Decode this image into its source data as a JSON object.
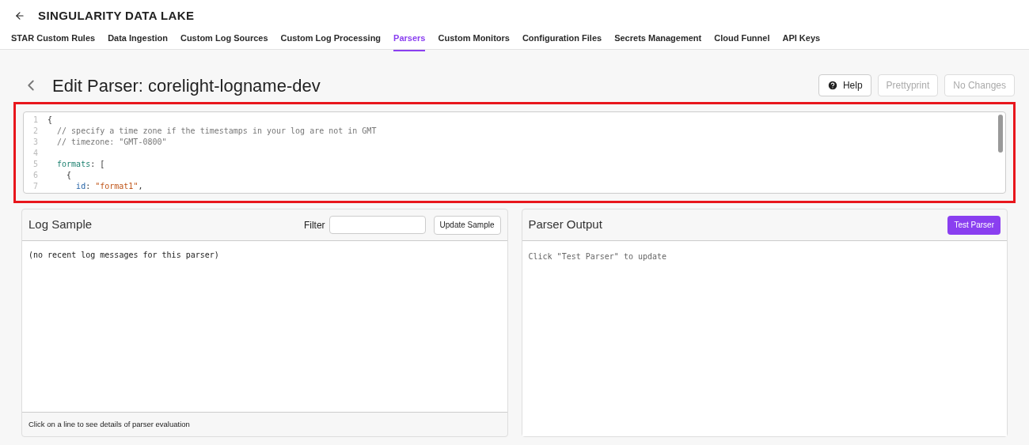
{
  "app_title": "SINGULARITY DATA LAKE",
  "tabs": [
    {
      "label": "STAR Custom Rules",
      "selected": false
    },
    {
      "label": "Data Ingestion",
      "selected": false
    },
    {
      "label": "Custom Log Sources",
      "selected": false
    },
    {
      "label": "Custom Log Processing",
      "selected": false
    },
    {
      "label": "Parsers",
      "selected": true
    },
    {
      "label": "Custom Monitors",
      "selected": false
    },
    {
      "label": "Configuration Files",
      "selected": false
    },
    {
      "label": "Secrets Management",
      "selected": false
    },
    {
      "label": "Cloud Funnel",
      "selected": false
    },
    {
      "label": "API Keys",
      "selected": false
    }
  ],
  "page_title": "Edit Parser: corelight-logname-dev",
  "buttons": [
    {
      "label": "Help",
      "disabled": false,
      "kind": "help"
    },
    {
      "label": "Prettyprint",
      "disabled": true,
      "kind": "plain"
    },
    {
      "label": "No Changes",
      "disabled": true,
      "kind": "plain"
    }
  ],
  "editor": {
    "highlighted": true,
    "lines": [
      {
        "number": "1",
        "tokens": [
          {
            "kind": "plain",
            "text": "{"
          }
        ]
      },
      {
        "number": "2",
        "tokens": [
          {
            "kind": "comment",
            "text": "  // specify a time zone if the timestamps in your log are not in GMT"
          }
        ]
      },
      {
        "number": "3",
        "tokens": [
          {
            "kind": "comment",
            "text": "  // timezone: \"GMT-0800\""
          }
        ]
      },
      {
        "number": "4"
      },
      {
        "number": "5",
        "tokens": [
          {
            "kind": "key",
            "text": "  formats"
          },
          {
            "kind": "plain",
            "text": ": ["
          }
        ]
      },
      {
        "number": "6",
        "tokens": [
          {
            "kind": "plain",
            "text": "    {"
          }
        ]
      },
      {
        "number": "7",
        "tokens": [
          {
            "kind": "id",
            "text": "      id"
          },
          {
            "kind": "plain",
            "text": ": "
          },
          {
            "kind": "string",
            "text": "\"format1\""
          },
          {
            "kind": "plain",
            "text": ","
          }
        ]
      }
    ]
  },
  "log_sample": {
    "title": "Log Sample",
    "filter_label": "Filter",
    "button": "Update Sample",
    "content": "(no recent log messages for this parser)",
    "footer": "Click on a line to see details of parser evaluation"
  },
  "parser_output": {
    "title": "Parser Output",
    "button": "Test Parser",
    "content": "Click \"Test Parser\" to update"
  }
}
